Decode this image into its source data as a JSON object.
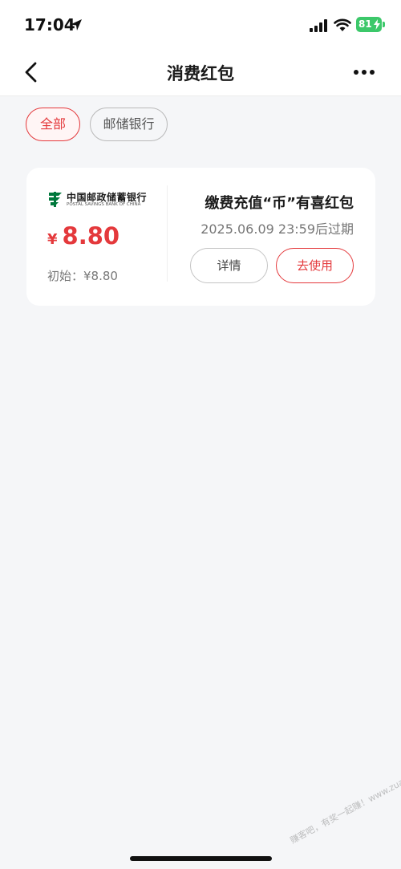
{
  "status_bar": {
    "time": "17:04",
    "battery": "81"
  },
  "nav": {
    "title": "消费红包"
  },
  "filters": [
    {
      "label": "全部",
      "selected": true
    },
    {
      "label": "邮储银行",
      "selected": false
    }
  ],
  "card": {
    "bank_logo_cn": "中国邮政储蓄银行",
    "bank_logo_en": "POSTAL SAVINGS BANK OF CHINA",
    "currency": "¥",
    "amount": "8.80",
    "initial": "初始：¥8.80",
    "title": "缴费充值“币”有喜红包",
    "expiry": "2025.06.09 23:59后过期",
    "detail_button": "详情",
    "use_button": "去使用"
  },
  "watermark": "赚客吧，有奖一起赚！www.zuanke8.com",
  "colors": {
    "accent": "#e4393c",
    "bank_green": "#00783c",
    "battery": "#3cc86a"
  }
}
